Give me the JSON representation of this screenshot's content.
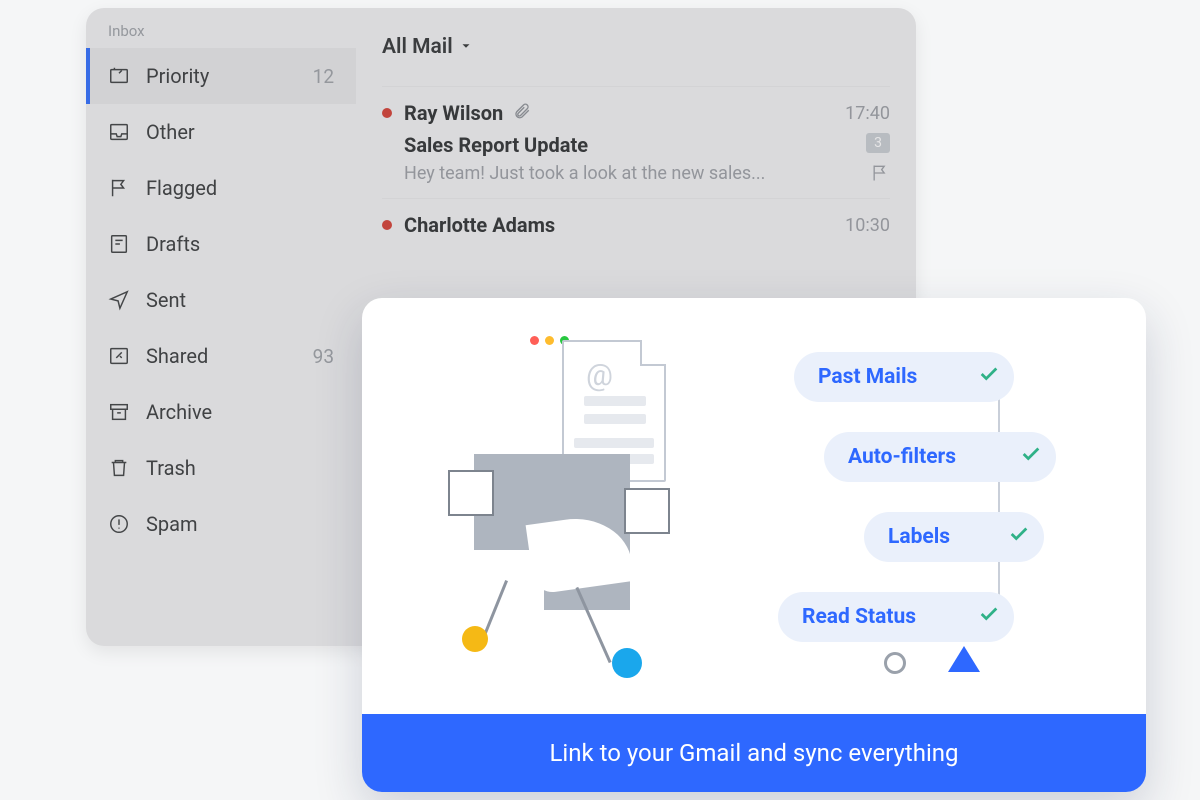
{
  "sidebar": {
    "title": "Inbox",
    "items": [
      {
        "icon": "priority-icon",
        "label": "Priority",
        "count": "12",
        "active": true
      },
      {
        "icon": "other-icon",
        "label": "Other",
        "count": ""
      },
      {
        "icon": "flag-icon",
        "label": "Flagged",
        "count": ""
      },
      {
        "icon": "drafts-icon",
        "label": "Drafts",
        "count": ""
      },
      {
        "icon": "sent-icon",
        "label": "Sent",
        "count": ""
      },
      {
        "icon": "shared-icon",
        "label": "Shared",
        "count": "93"
      },
      {
        "icon": "archive-icon",
        "label": "Archive",
        "count": ""
      },
      {
        "icon": "trash-icon",
        "label": "Trash",
        "count": ""
      },
      {
        "icon": "spam-icon",
        "label": "Spam",
        "count": ""
      }
    ]
  },
  "filter": {
    "label": "All Mail"
  },
  "messages": [
    {
      "sender": "Ray Wilson",
      "has_attachment": true,
      "time": "17:40",
      "subject": "Sales Report Update",
      "preview": "Hey team! Just took a look at the new sales...",
      "thread_count": "3"
    },
    {
      "sender": "Charlotte Adams",
      "has_attachment": false,
      "time": "10:30"
    }
  ],
  "promo": {
    "pills": [
      "Past Mails",
      "Auto-filters",
      "Labels",
      "Read Status"
    ],
    "footer": "Link to your Gmail and sync everything"
  }
}
